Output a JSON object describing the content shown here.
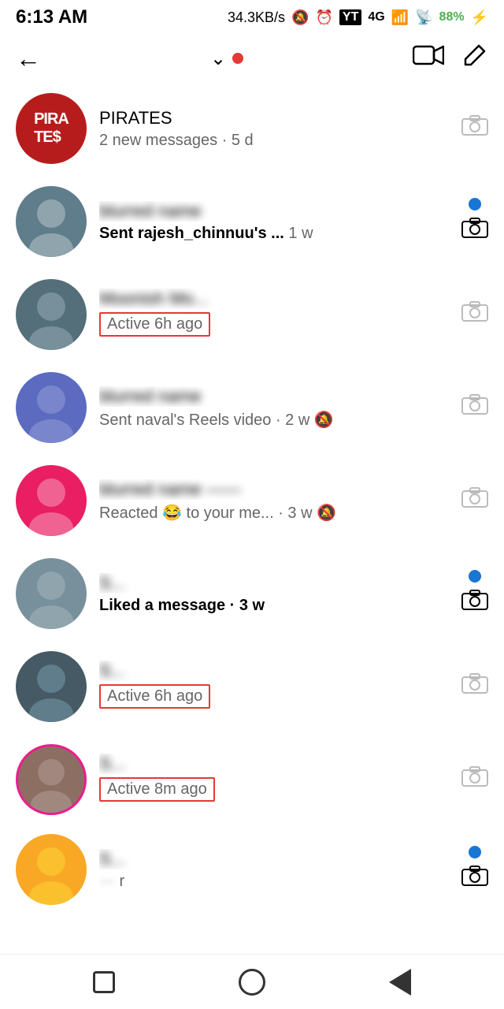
{
  "statusBar": {
    "time": "6:13 AM",
    "speed": "34.3KB/s",
    "icons": [
      "mute",
      "alarm",
      "ytm",
      "4g",
      "signal",
      "wifi",
      "battery"
    ],
    "batteryLevel": "88%"
  },
  "nav": {
    "backLabel": "←",
    "chevronLabel": "⌄",
    "videoCallLabel": "📹",
    "editLabel": "✏"
  },
  "conversations": [
    {
      "id": "conv1",
      "name": "PIRATES",
      "nameBlurred": false,
      "isPirates": true,
      "metaText": "2 new messages · 5 d",
      "metaBold": false,
      "isActive": false,
      "hasDot": false,
      "hasStoryRing": false,
      "timeAgo": "5 d"
    },
    {
      "id": "conv2",
      "name": "blurred",
      "nameBlurred": true,
      "metaText": "Sent rajesh_chinnuu's ...",
      "metaTime": "1 w",
      "metaBold": true,
      "isActive": false,
      "hasDot": true,
      "hasStoryRing": false
    },
    {
      "id": "conv3",
      "name": "Moonish Moo...",
      "nameBlurred": true,
      "metaText": "Active 6h ago",
      "metaBold": false,
      "isActive": true,
      "activeHighlight": true,
      "hasDot": false,
      "hasStoryRing": false
    },
    {
      "id": "conv4",
      "name": "blurred",
      "nameBlurred": true,
      "metaText": "Sent naval's Reels video · 2 w",
      "metaBold": false,
      "isActive": false,
      "hasDot": false,
      "hasMute": true,
      "hasStoryRing": false
    },
    {
      "id": "conv5",
      "name": "blurred",
      "nameBlurred": true,
      "metaText": "Reacted 😂 to your me... · 3 w",
      "metaBold": false,
      "isActive": false,
      "hasDot": false,
      "hasMute": true,
      "hasStoryRing": false
    },
    {
      "id": "conv6",
      "name": "S...",
      "nameBlurred": true,
      "metaText": "Liked a message · 3 w",
      "metaBold": true,
      "isActive": false,
      "hasDot": true,
      "hasStoryRing": false
    },
    {
      "id": "conv7",
      "name": "S...",
      "nameBlurred": true,
      "metaText": "Active 6h ago",
      "metaBold": false,
      "isActive": false,
      "activeHighlight": true,
      "hasDot": false,
      "hasStoryRing": false
    },
    {
      "id": "conv8",
      "name": "S...",
      "nameBlurred": true,
      "metaText": "Active 8m ago",
      "metaBold": false,
      "isActive": false,
      "activeHighlight": true,
      "hasDot": false,
      "hasStoryRing": true
    },
    {
      "id": "conv9",
      "name": "S...",
      "nameBlurred": true,
      "metaText": "...",
      "metaBold": false,
      "isActive": false,
      "hasDot": true,
      "hasStoryRing": false,
      "isPartial": true
    }
  ],
  "androidNav": {
    "squareLabel": "□",
    "circleLabel": "○",
    "triangleLabel": "◁"
  }
}
